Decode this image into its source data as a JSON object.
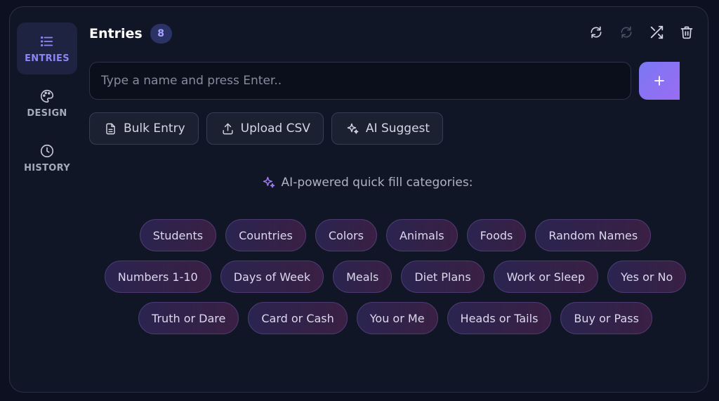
{
  "sidebar": {
    "items": [
      {
        "label": "ENTRIES",
        "icon": "list-icon",
        "active": true
      },
      {
        "label": "DESIGN",
        "icon": "palette-icon",
        "active": false
      },
      {
        "label": "HISTORY",
        "icon": "clock-icon",
        "active": false
      }
    ]
  },
  "header": {
    "title": "Entries",
    "count": "8"
  },
  "toolbar": {
    "icons": [
      "refresh-icon",
      "sync-icon",
      "shuffle-icon",
      "trash-icon"
    ]
  },
  "entry": {
    "placeholder": "Type a name and press Enter..",
    "value": ""
  },
  "actions": {
    "bulk": "Bulk Entry",
    "upload": "Upload CSV",
    "suggest": "AI Suggest"
  },
  "quick_fill": {
    "heading": "AI-powered quick fill categories:",
    "rows": [
      [
        "Students",
        "Countries",
        "Colors",
        "Animals",
        "Foods",
        "Random Names"
      ],
      [
        "Numbers 1-10",
        "Days of Week",
        "Meals",
        "Diet Plans",
        "Work or Sleep",
        "Yes or No"
      ],
      [
        "Truth or Dare",
        "Card or Cash",
        "You or Me",
        "Heads or Tails",
        "Buy or Pass"
      ]
    ]
  },
  "colors": {
    "accent": "#8b86f6",
    "add_button": "#8a72f3",
    "chip_border": "#4d3a70",
    "background": "#111627"
  }
}
